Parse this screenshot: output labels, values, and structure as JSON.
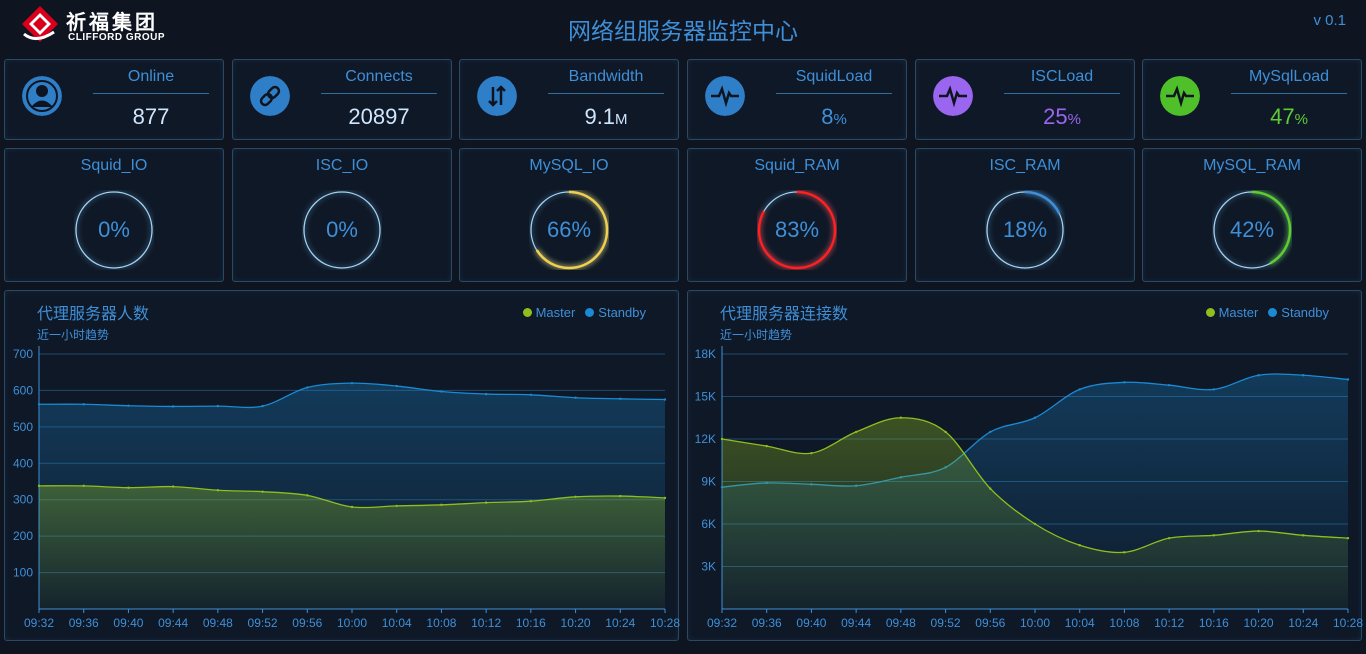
{
  "header": {
    "logo_cn": "祈福集团",
    "logo_en": "CLIFFORD GROUP",
    "title": "网络组服务器监控中心",
    "version": "v 0.1"
  },
  "stats": [
    {
      "label": "Online",
      "value": "877",
      "unit": "",
      "value_color": "#cfe6ff",
      "icon": "user-icon",
      "icon_bg": "#2f7fc8"
    },
    {
      "label": "Connects",
      "value": "20897",
      "unit": "",
      "value_color": "#cfe6ff",
      "icon": "link-icon",
      "icon_bg": "#2f7fc8"
    },
    {
      "label": "Bandwidth",
      "value": "9.1",
      "unit": "M",
      "value_color": "#cfe6ff",
      "icon": "transfer-icon",
      "icon_bg": "#2f7fc8"
    },
    {
      "label": "SquidLoad",
      "value": "8",
      "unit": "%",
      "value_color": "#3f8fd8",
      "icon": "pulse-icon",
      "icon_bg": "#2f7fc8"
    },
    {
      "label": "ISCLoad",
      "value": "25",
      "unit": "%",
      "value_color": "#9a66f0",
      "icon": "pulse-icon",
      "icon_bg": "#9a66f0"
    },
    {
      "label": "MySqlLoad",
      "value": "47",
      "unit": "%",
      "value_color": "#5fcc32",
      "icon": "pulse-icon",
      "icon_bg": "#4fc02a"
    }
  ],
  "gauges": [
    {
      "label": "Squid_IO",
      "value": 0,
      "text": "0%",
      "color": "#9cc8ee"
    },
    {
      "label": "ISC_IO",
      "value": 0,
      "text": "0%",
      "color": "#9cc8ee"
    },
    {
      "label": "MySQL_IO",
      "value": 0.66,
      "text": "66%",
      "color": "#f0d050"
    },
    {
      "label": "Squid_RAM",
      "value": 0.83,
      "text": "83%",
      "color": "#ff2020"
    },
    {
      "label": "ISC_RAM",
      "value": 0.18,
      "text": "18%",
      "color": "#3f8fd8"
    },
    {
      "label": "MySQL_RAM",
      "value": 0.42,
      "text": "42%",
      "color": "#5fcc32"
    }
  ],
  "colors": {
    "master": "#8fbe1e",
    "standby": "#1a8ad4",
    "grid": "#1f4a6e",
    "accent": "#3f8fd8"
  },
  "legend": {
    "master": "Master",
    "standby": "Standby"
  },
  "chart_data": [
    {
      "type": "area",
      "title": "代理服务器人数",
      "subtitle": "近一小时趋势",
      "x": [
        "09:32",
        "09:36",
        "09:40",
        "09:44",
        "09:48",
        "09:52",
        "09:56",
        "10:00",
        "10:04",
        "10:08",
        "10:12",
        "10:16",
        "10:20",
        "10:24",
        "10:28"
      ],
      "ylim": [
        0,
        700
      ],
      "yticks": [
        100,
        200,
        300,
        400,
        500,
        600,
        700
      ],
      "ytick_labels": [
        "100",
        "200",
        "300",
        "400",
        "500",
        "600",
        "700"
      ],
      "series": [
        {
          "name": "Standby",
          "values": [
            562,
            562,
            558,
            556,
            557,
            557,
            608,
            620,
            612,
            597,
            590,
            588,
            580,
            577,
            575
          ]
        },
        {
          "name": "Master",
          "values": [
            338,
            338,
            333,
            336,
            326,
            322,
            312,
            280,
            283,
            286,
            292,
            296,
            308,
            310,
            305
          ]
        }
      ]
    },
    {
      "type": "area",
      "title": "代理服务器连接数",
      "subtitle": "近一小时趋势",
      "x": [
        "09:32",
        "09:36",
        "09:40",
        "09:44",
        "09:48",
        "09:52",
        "09:56",
        "10:00",
        "10:04",
        "10:08",
        "10:12",
        "10:16",
        "10:20",
        "10:24",
        "10:28"
      ],
      "ylim": [
        0,
        18000
      ],
      "yticks": [
        3000,
        6000,
        9000,
        12000,
        15000,
        18000
      ],
      "ytick_labels": [
        "3K",
        "6K",
        "9K",
        "12K",
        "15K",
        "18K"
      ],
      "series": [
        {
          "name": "Standby",
          "values": [
            8600,
            8900,
            8800,
            8700,
            9300,
            10000,
            12500,
            13500,
            15500,
            16000,
            15800,
            15500,
            16500,
            16500,
            16200
          ]
        },
        {
          "name": "Master",
          "values": [
            12000,
            11500,
            11000,
            12500,
            13500,
            12500,
            8500,
            6000,
            4500,
            4000,
            5000,
            5200,
            5500,
            5200,
            5000
          ]
        }
      ]
    }
  ]
}
